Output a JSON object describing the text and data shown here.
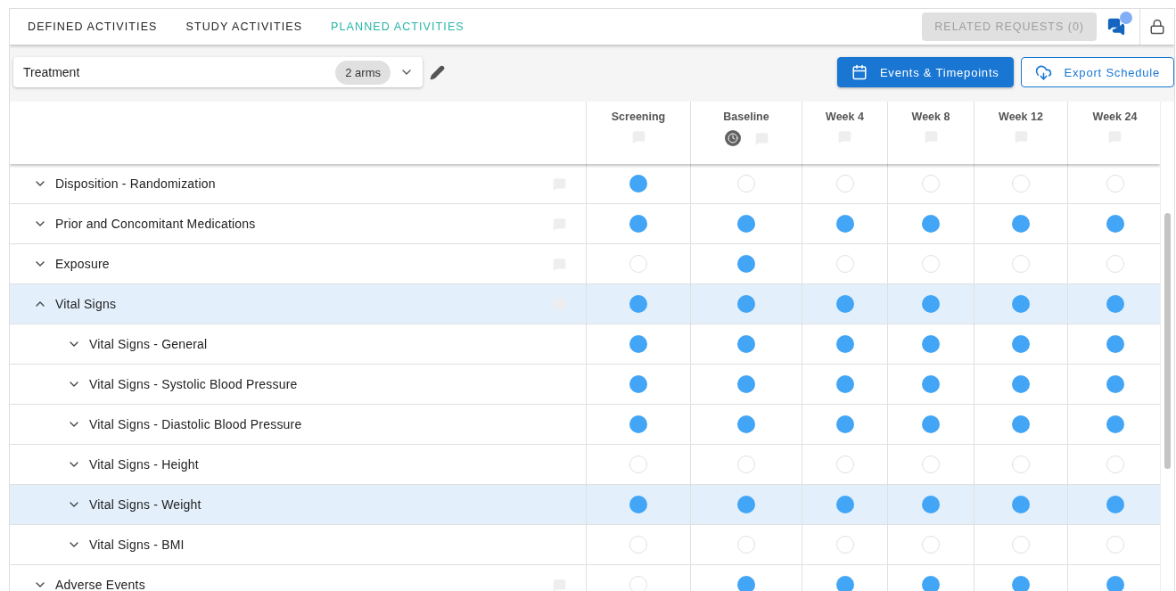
{
  "tabs": [
    {
      "label": "DEFINED ACTIVITIES",
      "selected": false
    },
    {
      "label": "STUDY ACTIVITIES",
      "selected": false
    },
    {
      "label": "PLANNED ACTIVITIES",
      "selected": true
    }
  ],
  "related_requests": {
    "label": "RELATED REQUESTS (0)",
    "disabled": true
  },
  "arm_select": {
    "value": "Treatment",
    "badge": "2 arms"
  },
  "buttons": [
    {
      "label": "Events & Timepoints",
      "kind": "primary"
    },
    {
      "label": "Export Schedule",
      "kind": "outlined"
    }
  ],
  "columns": [
    {
      "label": "Screening",
      "timed": false
    },
    {
      "label": "Baseline",
      "timed": true
    },
    {
      "label": "Week 4",
      "timed": false
    },
    {
      "label": "Week 8",
      "timed": false
    },
    {
      "label": "Week 12",
      "timed": false
    },
    {
      "label": "Week 24",
      "timed": false
    }
  ],
  "rows": [
    {
      "label": "Disposition - Randomization",
      "expanded": false,
      "selected": false,
      "planned": [
        true,
        false,
        false,
        false,
        false,
        false
      ]
    },
    {
      "label": "Prior and Concomitant Medications",
      "expanded": false,
      "selected": false,
      "planned": [
        true,
        true,
        true,
        true,
        true,
        true
      ]
    },
    {
      "label": "Exposure",
      "expanded": false,
      "selected": false,
      "planned": [
        false,
        true,
        false,
        false,
        false,
        false
      ]
    },
    {
      "label": "Vital Signs",
      "expanded": true,
      "selected": true,
      "planned": [
        true,
        true,
        true,
        true,
        true,
        true
      ],
      "children": [
        {
          "label": "Vital Signs - General",
          "expanded": false,
          "selected": false,
          "planned": [
            true,
            true,
            true,
            true,
            true,
            true
          ]
        },
        {
          "label": "Vital Signs - Systolic Blood Pressure",
          "expanded": false,
          "selected": false,
          "planned": [
            true,
            true,
            true,
            true,
            true,
            true
          ]
        },
        {
          "label": "Vital Signs - Diastolic Blood Pressure",
          "expanded": false,
          "selected": false,
          "planned": [
            true,
            true,
            true,
            true,
            true,
            true
          ]
        },
        {
          "label": "Vital Signs - Height",
          "expanded": false,
          "selected": false,
          "planned": [
            false,
            false,
            false,
            false,
            false,
            false
          ]
        },
        {
          "label": "Vital Signs - Weight",
          "expanded": false,
          "selected": true,
          "planned": [
            true,
            true,
            true,
            true,
            true,
            true
          ]
        },
        {
          "label": "Vital Signs - BMI",
          "expanded": false,
          "selected": false,
          "planned": [
            false,
            false,
            false,
            false,
            false,
            false
          ]
        }
      ]
    },
    {
      "label": "Adverse Events",
      "expanded": false,
      "selected": false,
      "planned": [
        false,
        true,
        true,
        true,
        true,
        true
      ]
    }
  ]
}
